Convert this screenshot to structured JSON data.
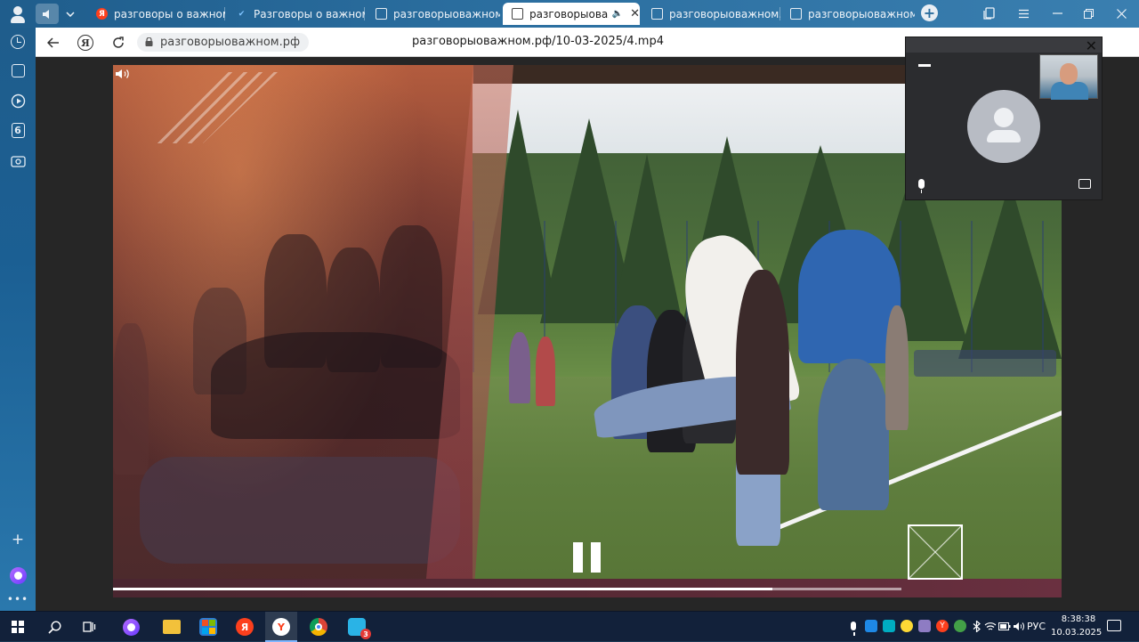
{
  "tabs": [
    {
      "label": "разговоры о важном о",
      "favicon": "yandex-icon",
      "active": false
    },
    {
      "label": "Разговоры о важном -",
      "favicon": "bird-icon",
      "active": false
    },
    {
      "label": "разговорыоважном.рф",
      "favicon": "document-icon",
      "active": false
    },
    {
      "label": "разговорыоважн",
      "favicon": "document-icon",
      "active": true
    },
    {
      "label": "разговорыоважном.рф",
      "favicon": "document-icon",
      "active": false
    },
    {
      "label": "разговорыоважном.рф",
      "favicon": "document-icon",
      "active": false
    }
  ],
  "address": {
    "domain": "разговорыоважном.рф",
    "url": "разговорыоважном.рф/10-03-2025/4.mp4"
  },
  "sidebar": {
    "badge_number": "6"
  },
  "video": {
    "state": "playing",
    "progress_fraction": 0.836
  },
  "call": {
    "participant_avatar": "person-placeholder",
    "self_view": true
  },
  "taskbar": {
    "language": "РУС",
    "time": "8:38:38",
    "date": "10.03.2025",
    "badge_count": "3"
  },
  "colors": {
    "accent": "#2a6d9e",
    "taskbar": "#12213a",
    "yandex_red": "#fc3f1d"
  }
}
